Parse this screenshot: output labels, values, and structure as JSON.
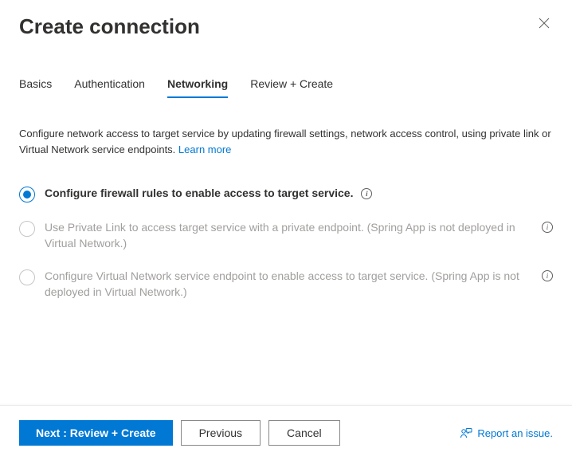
{
  "header": {
    "title": "Create connection"
  },
  "tabs": [
    {
      "label": "Basics",
      "active": false
    },
    {
      "label": "Authentication",
      "active": false
    },
    {
      "label": "Networking",
      "active": true
    },
    {
      "label": "Review + Create",
      "active": false
    }
  ],
  "networking": {
    "description": "Configure network access to target service by updating firewall settings, network access control, using private link or Virtual Network service endpoints.",
    "learn_more": "Learn more",
    "options": [
      {
        "label": "Configure firewall rules to enable access to target service.",
        "selected": true,
        "disabled": false,
        "info_inline": true
      },
      {
        "label": "Use Private Link to access target service with a private endpoint. (Spring App is not deployed in Virtual Network.)",
        "selected": false,
        "disabled": true,
        "info_inline": false
      },
      {
        "label": "Configure Virtual Network service endpoint to enable access to target service. (Spring App is not deployed in Virtual Network.)",
        "selected": false,
        "disabled": true,
        "info_inline": false
      }
    ]
  },
  "footer": {
    "next": "Next : Review + Create",
    "previous": "Previous",
    "cancel": "Cancel",
    "report": "Report an issue."
  }
}
